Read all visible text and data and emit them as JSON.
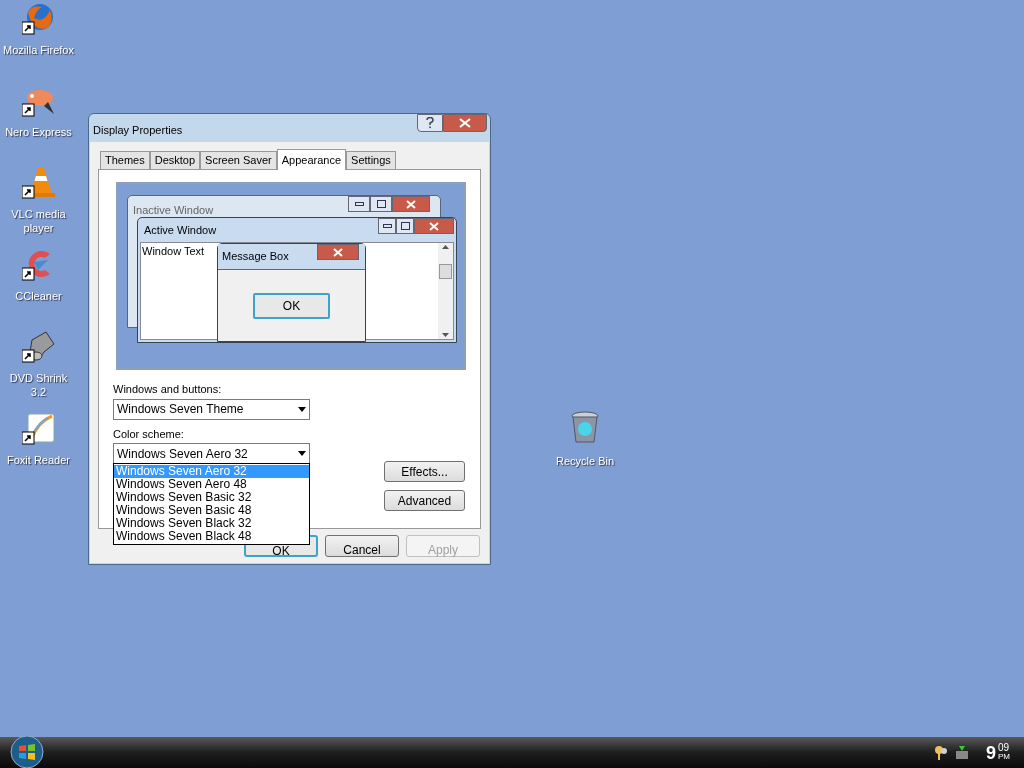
{
  "desktop_icons": [
    {
      "label": "Mozilla Firefox",
      "kind": "firefox"
    },
    {
      "label": "Nero Express",
      "kind": "nero"
    },
    {
      "label": "VLC media player",
      "kind": "vlc"
    },
    {
      "label": "CCleaner",
      "kind": "ccleaner"
    },
    {
      "label": "DVD Shrink 3.2",
      "kind": "dvdshrink"
    },
    {
      "label": "Foxit Reader",
      "kind": "foxit"
    }
  ],
  "recycle_bin": {
    "label": "Recycle Bin"
  },
  "dialog": {
    "title": "Display Properties",
    "tabs": [
      {
        "label": "Themes",
        "selected": false
      },
      {
        "label": "Desktop",
        "selected": false
      },
      {
        "label": "Screen Saver",
        "selected": false
      },
      {
        "label": "Appearance",
        "selected": true
      },
      {
        "label": "Settings",
        "selected": false
      }
    ],
    "preview": {
      "inactive_title": "Inactive Window",
      "active_title": "Active Window",
      "window_text": "Window Text",
      "message_box_title": "Message Box",
      "message_box_button": "OK"
    },
    "windows_and_buttons": {
      "label": "Windows and buttons:",
      "value": "Windows Seven Theme"
    },
    "color_scheme": {
      "label": "Color scheme:",
      "value": "Windows Seven Aero 32",
      "options": [
        {
          "label": "Windows Seven Aero 32",
          "selected": true
        },
        {
          "label": "Windows Seven Aero 48",
          "selected": false
        },
        {
          "label": "Windows Seven Basic 32",
          "selected": false
        },
        {
          "label": "Windows Seven Basic 48",
          "selected": false
        },
        {
          "label": "Windows Seven Black 32",
          "selected": false
        },
        {
          "label": "Windows Seven Black 48",
          "selected": false
        }
      ]
    },
    "side_buttons": [
      {
        "label": "Effects..."
      },
      {
        "label": "Advanced"
      }
    ],
    "footer_buttons": [
      {
        "label": "OK",
        "disabled": false
      },
      {
        "label": "Cancel",
        "disabled": false
      },
      {
        "label": "Apply",
        "disabled": true
      }
    ]
  },
  "taskbar": {
    "clock_hour": "9",
    "clock_minutes": "09",
    "clock_ampm": "PM"
  }
}
